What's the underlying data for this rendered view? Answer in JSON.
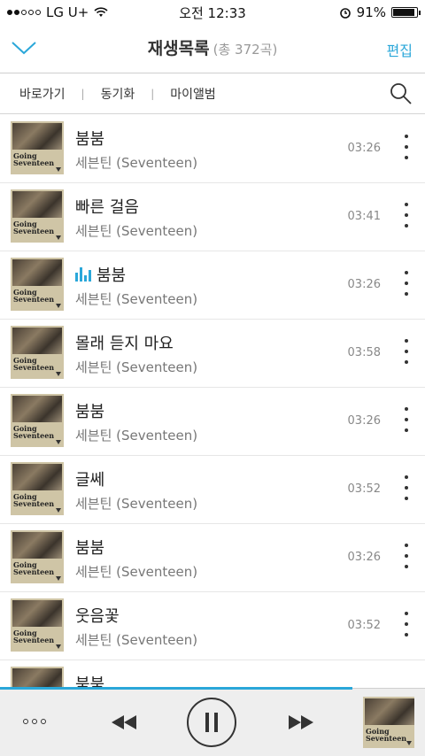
{
  "status_bar": {
    "carrier": "LG U+",
    "time": "오전 12:33",
    "battery": "91%",
    "battery_level": 0.91
  },
  "header": {
    "title": "재생목록",
    "count": "(총 372곡)",
    "edit": "편집",
    "back_icon": "chevron-down-icon"
  },
  "subnav": {
    "items": [
      "바로가기",
      "동기화",
      "마이앨범"
    ],
    "search_icon": "search-icon"
  },
  "cover_text": "Going\nSeventeen",
  "songs": [
    {
      "title": "붐붐",
      "artist": "세븐틴 (Seventeen)",
      "duration": "03:26",
      "playing": false
    },
    {
      "title": "빠른 걸음",
      "artist": "세븐틴 (Seventeen)",
      "duration": "03:41",
      "playing": false
    },
    {
      "title": "붐붐",
      "artist": "세븐틴 (Seventeen)",
      "duration": "03:26",
      "playing": true
    },
    {
      "title": "몰래 듣지 마요",
      "artist": "세븐틴 (Seventeen)",
      "duration": "03:58",
      "playing": false
    },
    {
      "title": "붐붐",
      "artist": "세븐틴 (Seventeen)",
      "duration": "03:26",
      "playing": false
    },
    {
      "title": "글쎄",
      "artist": "세븐틴 (Seventeen)",
      "duration": "03:52",
      "playing": false
    },
    {
      "title": "붐붐",
      "artist": "세븐틴 (Seventeen)",
      "duration": "03:26",
      "playing": false
    },
    {
      "title": "웃음꽃",
      "artist": "세븐틴 (Seventeen)",
      "duration": "03:52",
      "playing": false
    },
    {
      "title": "붐붐",
      "artist": "",
      "duration": "",
      "playing": false
    }
  ],
  "player": {
    "progress": 0.83,
    "more_icon": "more-dots-icon",
    "rewind_icon": "rewind-icon",
    "pause_icon": "pause-icon",
    "forward_icon": "fast-forward-icon"
  },
  "colors": {
    "accent": "#2aa7d9"
  }
}
